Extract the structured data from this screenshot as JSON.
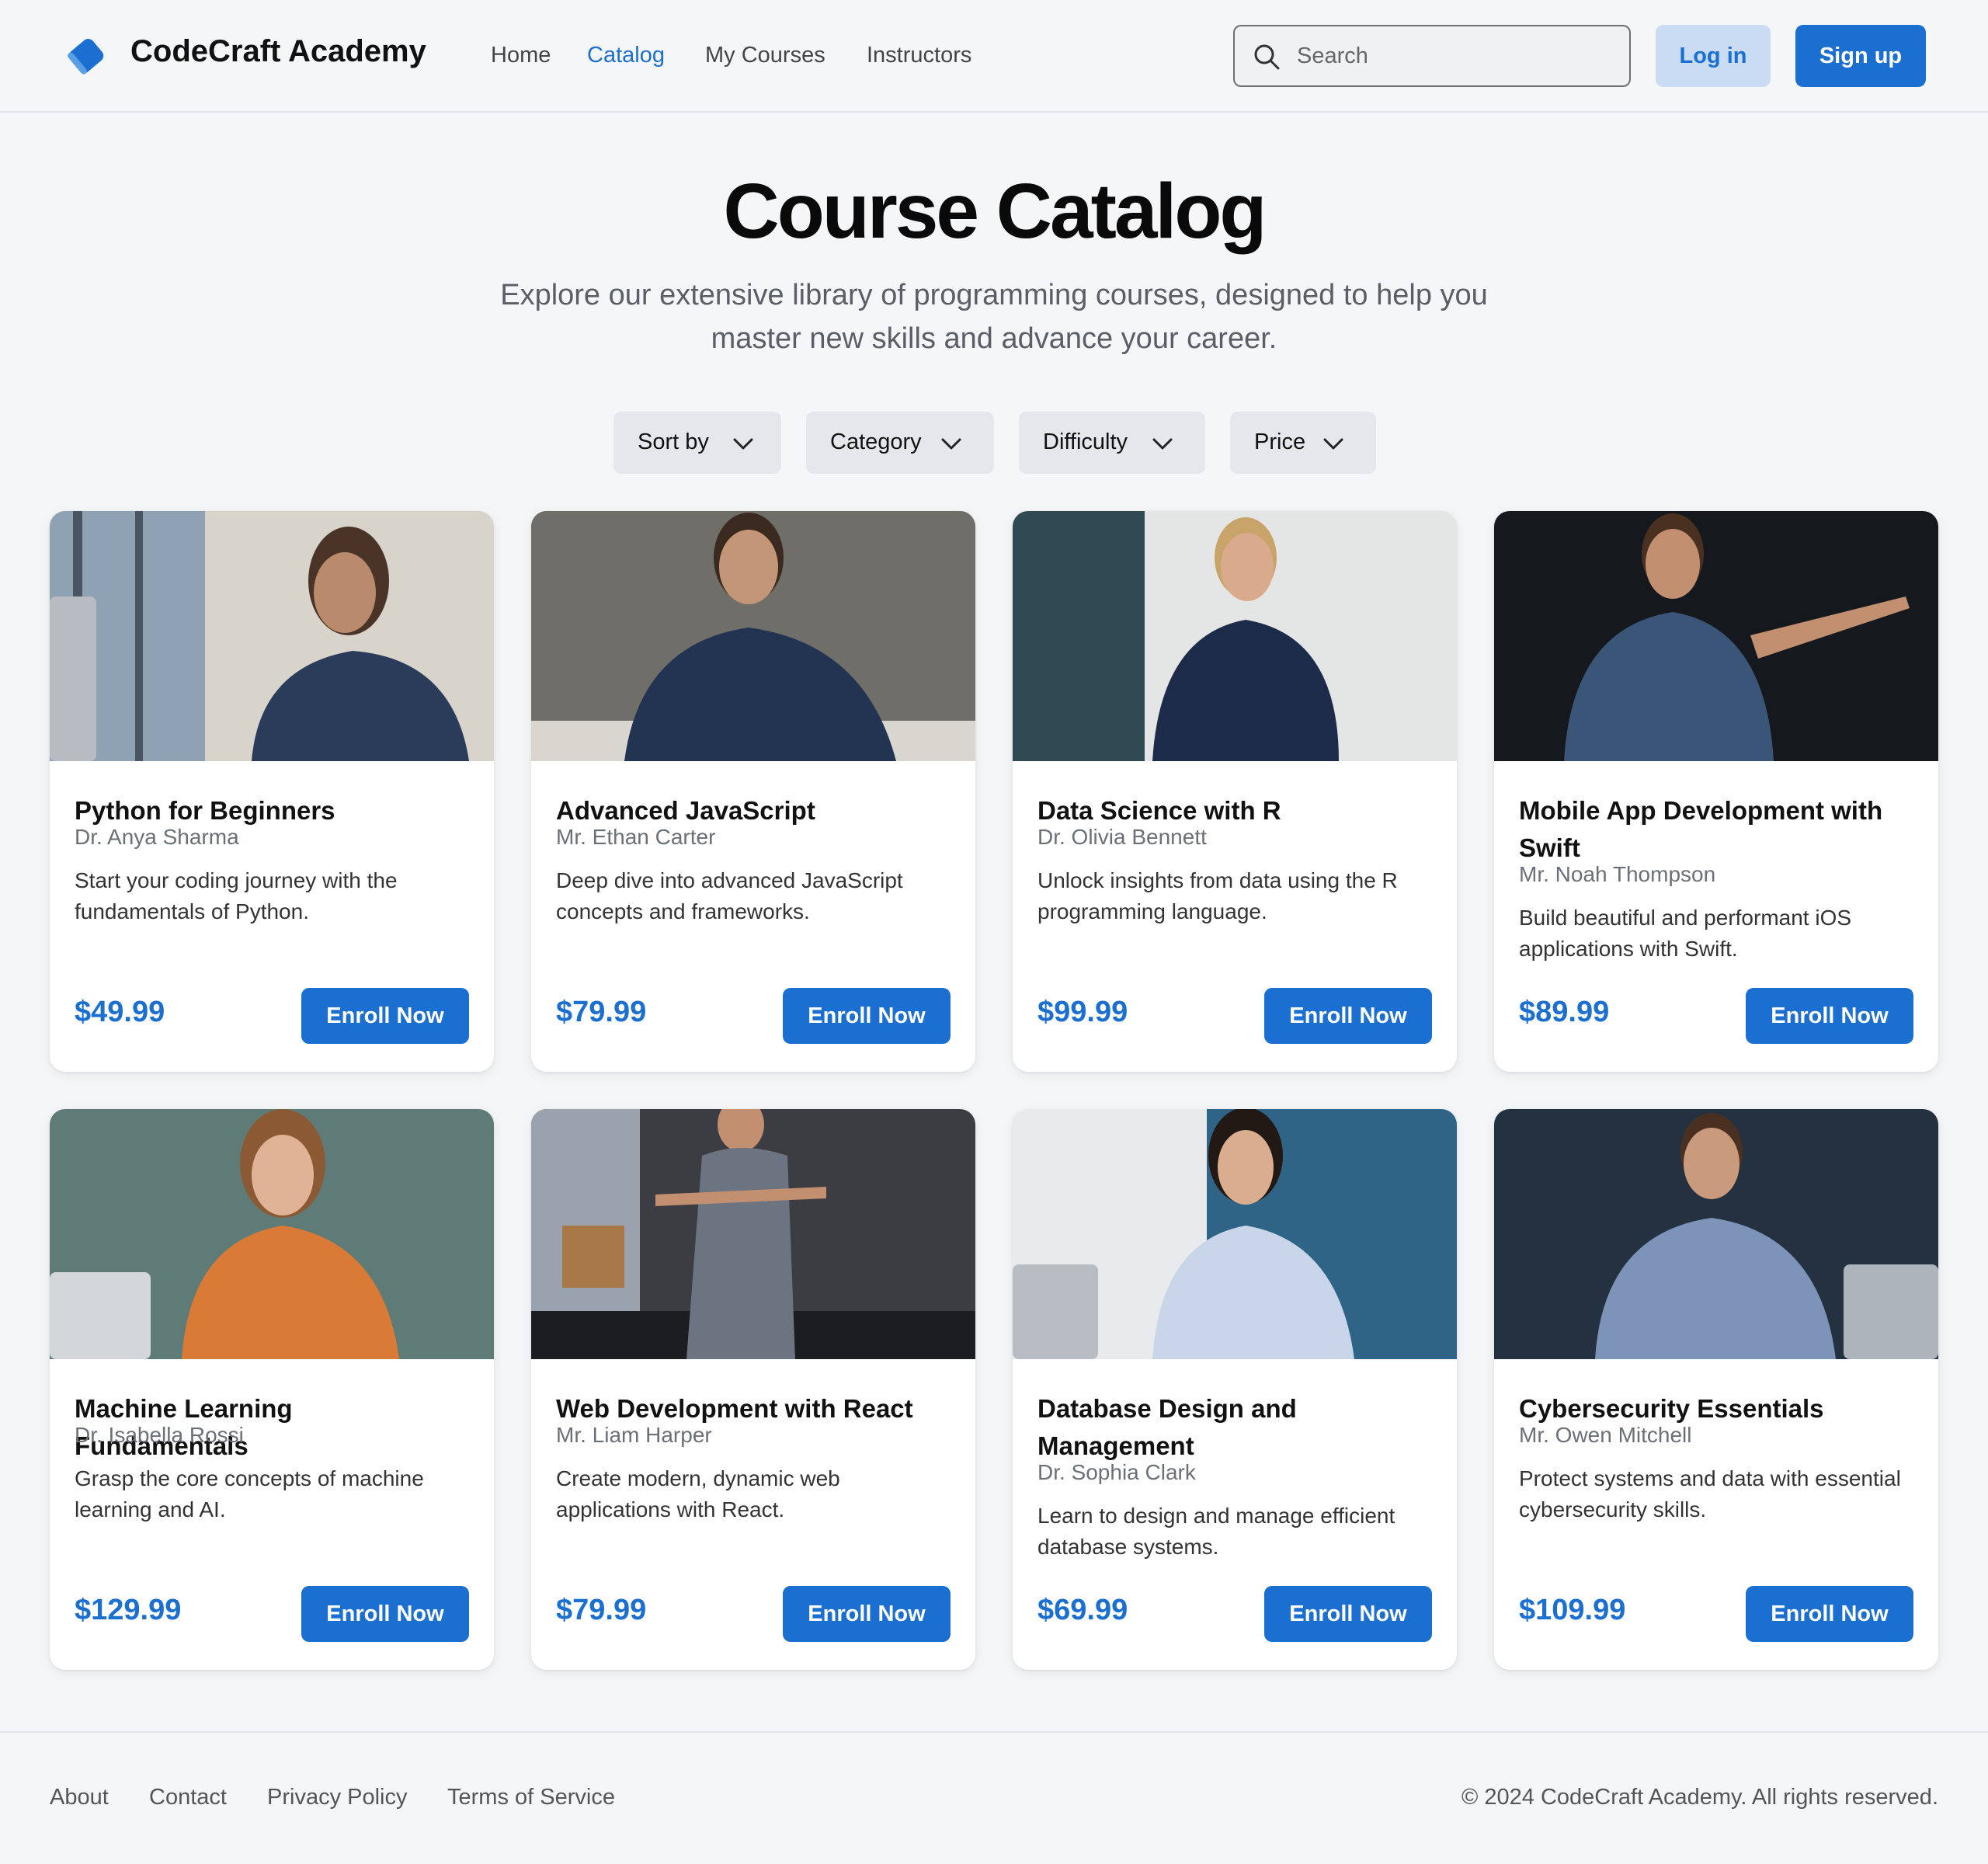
{
  "header": {
    "brand": "CodeCraft Academy",
    "logo_icon": "book-icon",
    "nav": [
      {
        "label": "Home",
        "active": false
      },
      {
        "label": "Catalog",
        "active": true
      },
      {
        "label": "My Courses",
        "active": false
      },
      {
        "label": "Instructors",
        "active": false
      }
    ],
    "search": {
      "placeholder": "Search",
      "value": ""
    },
    "login_label": "Log in",
    "signup_label": "Sign up"
  },
  "hero": {
    "title": "Course Catalog",
    "subtitle": "Explore our extensive library of programming courses, designed to help you master new skills and advance your career."
  },
  "filters": [
    {
      "label": "Sort by"
    },
    {
      "label": "Category"
    },
    {
      "label": "Difficulty"
    },
    {
      "label": "Price"
    }
  ],
  "courses": [
    {
      "title": "Python for Beginners",
      "instructor": "Dr. Anya Sharma",
      "description": "Start your coding journey with the fundamentals of Python.",
      "price": "$49.99",
      "button": "Enroll Now"
    },
    {
      "title": "Advanced JavaScript",
      "instructor": "Mr. Ethan Carter",
      "description": "Deep dive into advanced JavaScript concepts and frameworks.",
      "price": "$79.99",
      "button": "Enroll Now"
    },
    {
      "title": "Data Science with R",
      "instructor": "Dr. Olivia Bennett",
      "description": "Unlock insights from data using the R programming language.",
      "price": "$99.99",
      "button": "Enroll Now"
    },
    {
      "title": "Mobile App Development with Swift",
      "instructor": "Mr. Noah Thompson",
      "description": "Build beautiful and performant iOS applications with Swift.",
      "price": "$89.99",
      "button": "Enroll Now"
    },
    {
      "title": "Machine Learning Fundamentals",
      "instructor": "Dr. Isabella Rossi",
      "description": "Grasp the core concepts of machine learning and AI.",
      "price": "$129.99",
      "button": "Enroll Now"
    },
    {
      "title": "Web Development with React",
      "instructor": "Mr. Liam Harper",
      "description": "Create modern, dynamic web applications with React.",
      "price": "$79.99",
      "button": "Enroll Now"
    },
    {
      "title": "Database Design and Management",
      "instructor": "Dr. Sophia Clark",
      "description": "Learn to design and manage efficient database systems.",
      "price": "$69.99",
      "button": "Enroll Now"
    },
    {
      "title": "Cybersecurity Essentials",
      "instructor": "Mr. Owen Mitchell",
      "description": "Protect systems and data with essential cybersecurity skills.",
      "price": "$109.99",
      "button": "Enroll Now"
    }
  ],
  "footer": {
    "links": [
      "About",
      "Contact",
      "Privacy Policy",
      "Terms of Service"
    ],
    "copyright": "© 2024 CodeCraft Academy. All rights reserved."
  },
  "colors": {
    "accent": "#1a6fd1",
    "accent_light": "#c9dcf3",
    "background": "#f5f6f8",
    "card": "#ffffff"
  }
}
